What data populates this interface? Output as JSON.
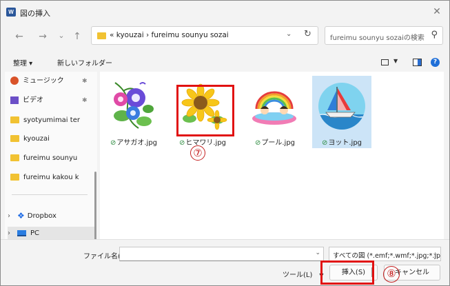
{
  "window": {
    "app_icon_letter": "W",
    "title": "図の挿入",
    "close_glyph": "✕"
  },
  "address_bar": {
    "back_glyph": "←",
    "forward_glyph": "→",
    "recent_glyph": "⌄",
    "up_glyph": "↑",
    "path": "« kyouzai › fureimu sounyu sozai",
    "dropdown_glyph": "⌄",
    "refresh_glyph": "↻",
    "search_placeholder": "fureimu sounyu sozaiの検索"
  },
  "toolbar": {
    "organize_label": "整理 ▾",
    "new_folder_label": "新しいフォルダー"
  },
  "nav_pane": {
    "items": [
      {
        "label": "ミュージック",
        "icon": "music-icon",
        "pinned": true
      },
      {
        "label": "ビデオ",
        "icon": "video-icon",
        "pinned": true
      },
      {
        "label": "syotyumimai ter",
        "icon": "folder-icon",
        "pinned": false
      },
      {
        "label": "kyouzai",
        "icon": "folder-icon",
        "pinned": false
      },
      {
        "label": "fureimu sounyu",
        "icon": "folder-icon",
        "pinned": false
      },
      {
        "label": "fureimu kakou k",
        "icon": "folder-icon",
        "pinned": false
      }
    ],
    "dropbox_label": "Dropbox",
    "pc_label": "PC",
    "pin_glyph": "📌",
    "expand_glyph": "›"
  },
  "files": [
    {
      "name": "アサガオ.jpg",
      "selected": false
    },
    {
      "name": "ヒマワリ.jpg",
      "selected": false
    },
    {
      "name": "プール.jpg",
      "selected": false
    },
    {
      "name": "ヨット.jpg",
      "selected": true
    }
  ],
  "status_glyph": "⊘",
  "annotations": {
    "step7": "⑦",
    "step8": "⑧"
  },
  "footer": {
    "filename_label": "ファイル名(N):",
    "filename_value": "",
    "filter_value": "すべての図 (*.emf;*.wmf;*.jpg;*.jp",
    "tools_label": "ツール(L)",
    "insert_label": "挿入(S)",
    "cancel_label": "キャンセル"
  },
  "colors": {
    "accent_blue": "#1f6fd8",
    "selection": "#cce4f7",
    "annotation_red": "#e11111"
  }
}
